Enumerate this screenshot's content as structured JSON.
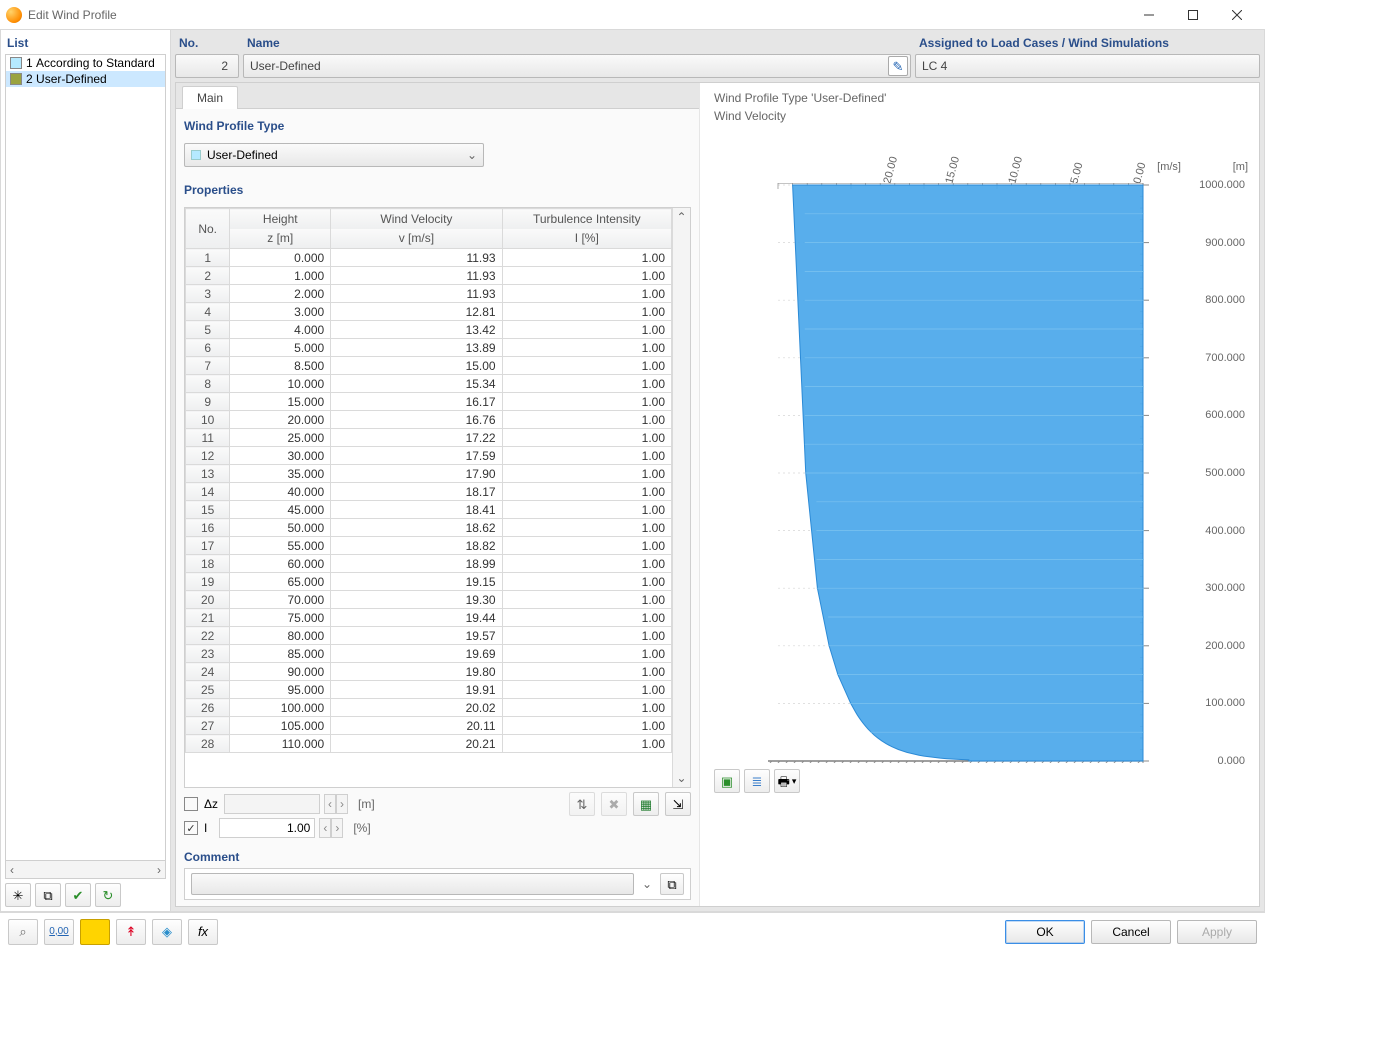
{
  "window": {
    "title": "Edit Wind Profile"
  },
  "list": {
    "header": "List",
    "items": [
      {
        "no": "1",
        "label": "According to Standard",
        "color": "#b5eaff"
      },
      {
        "no": "2",
        "label": "User-Defined",
        "color": "#9aa340"
      }
    ],
    "selected_index": 1
  },
  "header": {
    "no_label": "No.",
    "no_value": "2",
    "name_label": "Name",
    "name_value": "User-Defined",
    "assigned_label": "Assigned to Load Cases / Wind Simulations",
    "assigned_value": "LC 4"
  },
  "tabs": [
    "Main"
  ],
  "wind_profile_type": {
    "section_label": "Wind Profile Type",
    "selected": "User-Defined"
  },
  "properties": {
    "section_label": "Properties",
    "columns": {
      "no": "No.",
      "height_top": "Height",
      "height_sub": "z [m]",
      "velocity_top": "Wind Velocity",
      "velocity_sub": "v [m/s]",
      "intensity_top": "Turbulence Intensity",
      "intensity_sub": "I [%]"
    },
    "rows": [
      {
        "n": 1,
        "z": "0.000",
        "v": "11.93",
        "i": "1.00"
      },
      {
        "n": 2,
        "z": "1.000",
        "v": "11.93",
        "i": "1.00"
      },
      {
        "n": 3,
        "z": "2.000",
        "v": "11.93",
        "i": "1.00"
      },
      {
        "n": 4,
        "z": "3.000",
        "v": "12.81",
        "i": "1.00"
      },
      {
        "n": 5,
        "z": "4.000",
        "v": "13.42",
        "i": "1.00"
      },
      {
        "n": 6,
        "z": "5.000",
        "v": "13.89",
        "i": "1.00"
      },
      {
        "n": 7,
        "z": "8.500",
        "v": "15.00",
        "i": "1.00"
      },
      {
        "n": 8,
        "z": "10.000",
        "v": "15.34",
        "i": "1.00"
      },
      {
        "n": 9,
        "z": "15.000",
        "v": "16.17",
        "i": "1.00"
      },
      {
        "n": 10,
        "z": "20.000",
        "v": "16.76",
        "i": "1.00"
      },
      {
        "n": 11,
        "z": "25.000",
        "v": "17.22",
        "i": "1.00"
      },
      {
        "n": 12,
        "z": "30.000",
        "v": "17.59",
        "i": "1.00"
      },
      {
        "n": 13,
        "z": "35.000",
        "v": "17.90",
        "i": "1.00"
      },
      {
        "n": 14,
        "z": "40.000",
        "v": "18.17",
        "i": "1.00"
      },
      {
        "n": 15,
        "z": "45.000",
        "v": "18.41",
        "i": "1.00"
      },
      {
        "n": 16,
        "z": "50.000",
        "v": "18.62",
        "i": "1.00"
      },
      {
        "n": 17,
        "z": "55.000",
        "v": "18.82",
        "i": "1.00"
      },
      {
        "n": 18,
        "z": "60.000",
        "v": "18.99",
        "i": "1.00"
      },
      {
        "n": 19,
        "z": "65.000",
        "v": "19.15",
        "i": "1.00"
      },
      {
        "n": 20,
        "z": "70.000",
        "v": "19.30",
        "i": "1.00"
      },
      {
        "n": 21,
        "z": "75.000",
        "v": "19.44",
        "i": "1.00"
      },
      {
        "n": 22,
        "z": "80.000",
        "v": "19.57",
        "i": "1.00"
      },
      {
        "n": 23,
        "z": "85.000",
        "v": "19.69",
        "i": "1.00"
      },
      {
        "n": 24,
        "z": "90.000",
        "v": "19.80",
        "i": "1.00"
      },
      {
        "n": 25,
        "z": "95.000",
        "v": "19.91",
        "i": "1.00"
      },
      {
        "n": 26,
        "z": "100.000",
        "v": "20.02",
        "i": "1.00"
      },
      {
        "n": 27,
        "z": "105.000",
        "v": "20.11",
        "i": "1.00"
      },
      {
        "n": 28,
        "z": "110.000",
        "v": "20.21",
        "i": "1.00"
      }
    ]
  },
  "bottom_inputs": {
    "dz_label": "Δz",
    "dz_unit": "[m]",
    "dz_value": "",
    "dz_checked": false,
    "i_label": "I",
    "i_unit": "[%]",
    "i_value": "1.00",
    "i_checked": true
  },
  "comment": {
    "label": "Comment",
    "value": ""
  },
  "chart": {
    "title1": "Wind Profile Type 'User-Defined'",
    "title2": "Wind Velocity",
    "x_unit": "[m/s]",
    "y_unit": "[m]"
  },
  "chart_data": {
    "type": "area",
    "title": "Wind Velocity",
    "xlabel": "[m/s]",
    "ylabel": "[m]",
    "orientation": "horizontal",
    "x_range": [
      0,
      25
    ],
    "x_ticks": [
      0.0,
      5.0,
      10.0,
      15.0,
      20.0
    ],
    "x_reversed": true,
    "y_range": [
      0,
      1000
    ],
    "y_ticks": [
      0,
      100,
      200,
      300,
      400,
      500,
      600,
      700,
      800,
      900,
      1000
    ],
    "series": [
      {
        "name": "Wind Velocity",
        "color": "#4aa7ea",
        "points": [
          {
            "z": 0,
            "v": 11.93
          },
          {
            "z": 1,
            "v": 11.93
          },
          {
            "z": 2,
            "v": 11.93
          },
          {
            "z": 3,
            "v": 12.81
          },
          {
            "z": 4,
            "v": 13.42
          },
          {
            "z": 5,
            "v": 13.89
          },
          {
            "z": 8.5,
            "v": 15.0
          },
          {
            "z": 10,
            "v": 15.34
          },
          {
            "z": 15,
            "v": 16.17
          },
          {
            "z": 20,
            "v": 16.76
          },
          {
            "z": 25,
            "v": 17.22
          },
          {
            "z": 30,
            "v": 17.59
          },
          {
            "z": 35,
            "v": 17.9
          },
          {
            "z": 40,
            "v": 18.17
          },
          {
            "z": 45,
            "v": 18.41
          },
          {
            "z": 50,
            "v": 18.62
          },
          {
            "z": 55,
            "v": 18.82
          },
          {
            "z": 60,
            "v": 18.99
          },
          {
            "z": 65,
            "v": 19.15
          },
          {
            "z": 70,
            "v": 19.3
          },
          {
            "z": 75,
            "v": 19.44
          },
          {
            "z": 80,
            "v": 19.57
          },
          {
            "z": 85,
            "v": 19.69
          },
          {
            "z": 90,
            "v": 19.8
          },
          {
            "z": 95,
            "v": 19.91
          },
          {
            "z": 100,
            "v": 20.02
          },
          {
            "z": 150,
            "v": 20.9
          },
          {
            "z": 200,
            "v": 21.5
          },
          {
            "z": 300,
            "v": 22.3
          },
          {
            "z": 500,
            "v": 23.1
          },
          {
            "z": 1000,
            "v": 24.0
          }
        ]
      }
    ]
  },
  "buttons": {
    "ok": "OK",
    "cancel": "Cancel",
    "apply": "Apply"
  }
}
